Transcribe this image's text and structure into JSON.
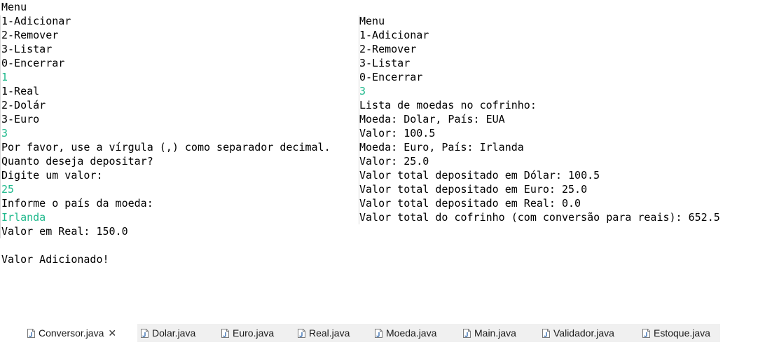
{
  "console_left": {
    "lines": [
      {
        "text": "Menu",
        "input": false
      },
      {
        "text": "1-Adicionar",
        "input": false
      },
      {
        "text": "2-Remover",
        "input": false
      },
      {
        "text": "3-Listar",
        "input": false
      },
      {
        "text": "0-Encerrar",
        "input": false
      },
      {
        "text": "1",
        "input": true
      },
      {
        "text": "1-Real",
        "input": false
      },
      {
        "text": "2-Dolár",
        "input": false
      },
      {
        "text": "3-Euro",
        "input": false
      },
      {
        "text": "3",
        "input": true
      },
      {
        "text": "Por favor, use a vírgula (,) como separador decimal.",
        "input": false
      },
      {
        "text": "Quanto deseja depositar?",
        "input": false
      },
      {
        "text": "Digite um valor:",
        "input": false
      },
      {
        "text": "25",
        "input": true
      },
      {
        "text": "Informe o país da moeda:",
        "input": false
      },
      {
        "text": "Irlanda",
        "input": true
      },
      {
        "text": "Valor em Real: 150.0",
        "input": false
      },
      {
        "text": "",
        "input": false
      },
      {
        "text": "Valor Adicionado!",
        "input": false
      }
    ]
  },
  "console_right": {
    "lines": [
      {
        "text": "Menu",
        "input": false
      },
      {
        "text": "1-Adicionar",
        "input": false
      },
      {
        "text": "2-Remover",
        "input": false
      },
      {
        "text": "3-Listar",
        "input": false
      },
      {
        "text": "0-Encerrar",
        "input": false
      },
      {
        "text": "3",
        "input": true
      },
      {
        "text": "Lista de moedas no cofrinho:",
        "input": false
      },
      {
        "text": "Moeda: Dolar, País: EUA",
        "input": false
      },
      {
        "text": "Valor: 100.5",
        "input": false
      },
      {
        "text": "Moeda: Euro, País: Irlanda",
        "input": false
      },
      {
        "text": "Valor: 25.0",
        "input": false
      },
      {
        "text": "Valor total depositado em Dólar: 100.5",
        "input": false
      },
      {
        "text": "Valor total depositado em Euro: 25.0",
        "input": false
      },
      {
        "text": "Valor total depositado em Real: 0.0",
        "input": false
      },
      {
        "text": "Valor total do cofrinho (com conversão para reais): 652.5",
        "input": false
      }
    ]
  },
  "colors": {
    "input_text": "#1fb98c",
    "tab_bar_bg": "#f0f0f0",
    "active_tab_bg": "#ffffff"
  },
  "tabs": [
    {
      "label": "Conversor.java",
      "active": true,
      "closable": true,
      "icon": "java-file-icon"
    },
    {
      "label": "Dolar.java",
      "active": false,
      "closable": false,
      "icon": "java-file-icon"
    },
    {
      "label": "Euro.java",
      "active": false,
      "closable": false,
      "icon": "java-file-icon"
    },
    {
      "label": "Real.java",
      "active": false,
      "closable": false,
      "icon": "java-file-icon"
    },
    {
      "label": "Moeda.java",
      "active": false,
      "closable": false,
      "icon": "java-file-icon"
    },
    {
      "label": "Main.java",
      "active": false,
      "closable": false,
      "icon": "java-file-icon"
    },
    {
      "label": "Validador.java",
      "active": false,
      "closable": false,
      "icon": "java-file-icon"
    },
    {
      "label": "Estoque.java",
      "active": false,
      "closable": false,
      "icon": "java-file-icon"
    }
  ],
  "close_glyph": "✕"
}
